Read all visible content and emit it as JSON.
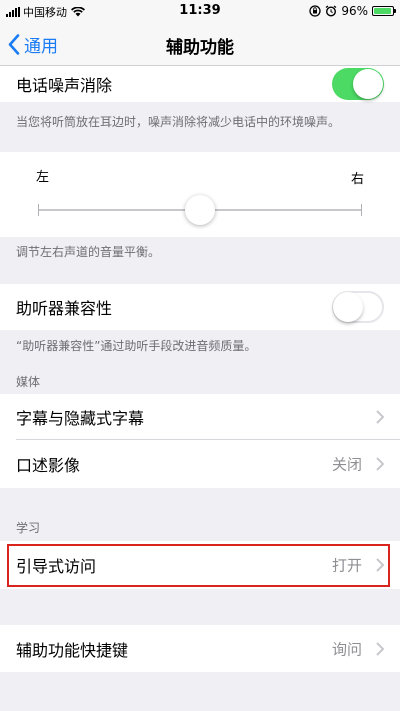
{
  "status_bar": {
    "carrier": "中国移动",
    "time": "11:39",
    "battery_text": "96%",
    "battery_level": 0.96,
    "icons": [
      "signal-icon",
      "wifi-icon",
      "lock-rotation-icon",
      "alarm-icon",
      "battery-icon"
    ]
  },
  "nav": {
    "back_label": "通用",
    "title": "辅助功能"
  },
  "noise_cancel": {
    "label": "电话噪声消除",
    "on": true,
    "footer": "当您将听筒放在耳边时，噪声消除将减少电话中的环境噪声。"
  },
  "balance": {
    "left_label": "左",
    "right_label": "右",
    "value": 0.5,
    "footer": "调节左右声道的音量平衡。"
  },
  "hearing_aid": {
    "label": "助听器兼容性",
    "on": false,
    "footer": "“助听器兼容性”通过助听手段改进音频质量。"
  },
  "media": {
    "header": "媒体",
    "items": [
      {
        "label": "字幕与隐藏式字幕",
        "value": ""
      },
      {
        "label": "口述影像",
        "value": "关闭"
      }
    ]
  },
  "learning": {
    "header": "学习",
    "items": [
      {
        "label": "引导式访问",
        "value": "打开"
      }
    ]
  },
  "shortcut": {
    "label": "辅助功能快捷键",
    "value": "询问"
  },
  "colors": {
    "accent": "#1a7cf5",
    "toggle_on": "#4cd964",
    "highlight": "#d9231d"
  }
}
